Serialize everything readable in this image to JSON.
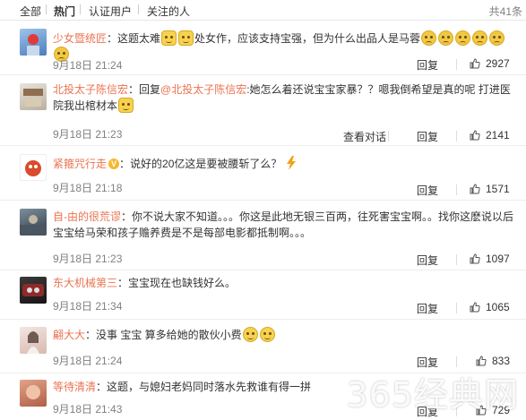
{
  "tabs": [
    "全部",
    "热门",
    "认证用户",
    "关注的人"
  ],
  "total": "共41条",
  "comments": [
    {
      "user": "少女暨统匠",
      "text_a": "：这题太难",
      "text_b": "处女作，应该支持宝强，但为什么出品人是马蓉",
      "time": "9月18日 21:24",
      "reply": "回复",
      "likes": "2927"
    },
    {
      "user": "北投太子陈信宏",
      "text_a": "：回复",
      "mention": "@北投太子陈信宏",
      "text_b": ":她怎么着还说宝宝家暴？？嗯我倒希望是真的呢 打进医院我出棺材本",
      "time": "9月18日 21:23",
      "view_conv": "查看对话",
      "reply": "回复",
      "likes": "2141"
    },
    {
      "user": "紧箍咒行走",
      "text_a": "：说好的20亿这是要被腰斩了么？",
      "time": "9月18日 21:18",
      "reply": "回复",
      "likes": "1571"
    },
    {
      "user": "自-由的很荒谬",
      "text_a": "：你不说大家不知道。。。你这是此地无银三百两，往死害宝宝啊。。找你这麽说以后宝宝给马荣和孩子赡养费是不是每部电影都抵制啊。。。",
      "time": "9月18日 21:23",
      "reply": "回复",
      "likes": "1097"
    },
    {
      "user": "东大机械第三",
      "text_a": "：宝宝现在也缺钱好么。",
      "time": "9月18日 21:34",
      "reply": "回复",
      "likes": "1065"
    },
    {
      "user": "翩大大",
      "text_a": "：没事 宝宝 算多给她的散伙小费",
      "time": "9月18日 21:24",
      "reply": "回复",
      "likes": "833"
    },
    {
      "user": "等待清清",
      "text_a": "：这题，与媳妇老妈同时落水先救谁有得一拼",
      "time": "9月18日 21:43",
      "reply": "回复",
      "likes": "729"
    }
  ],
  "watermark": "365经典网",
  "colors": {
    "username": "#eb7350",
    "meta": "#808080"
  }
}
